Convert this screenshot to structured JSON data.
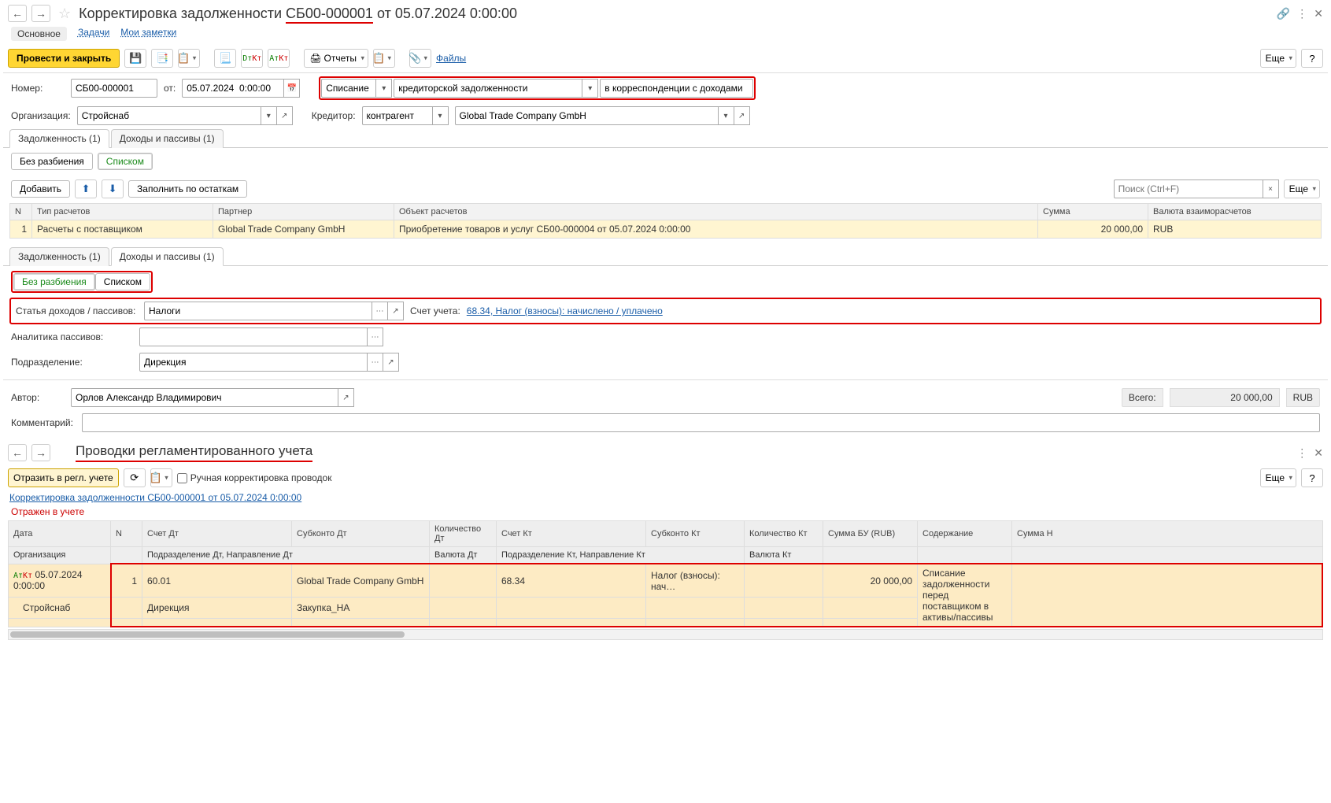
{
  "header": {
    "title_prefix": "Корректировка задолженности ",
    "title_highlight": "СБ00-000001",
    "title_suffix": " от 05.07.2024 0:00:00"
  },
  "nav": {
    "main": "Основное",
    "tasks": "Задачи",
    "notes": "Мои заметки"
  },
  "toolbar": {
    "post_close": "Провести и закрыть",
    "reports": "Отчеты",
    "files": "Файлы",
    "more": "Еще"
  },
  "fields": {
    "number_label": "Номер:",
    "number": "СБ00-000001",
    "from_label": "от:",
    "date": "05.07.2024  0:00:00",
    "op1": "Списание",
    "op2": "кредиторской задолженности",
    "op3": "в корреспонденции с доходами",
    "org_label": "Организация:",
    "org": "Стройснаб",
    "creditor_label": "Кредитор:",
    "creditor_type": "контрагент",
    "creditor": "Global Trade Company GmbH"
  },
  "tabs1": {
    "t1": "Задолженность (1)",
    "t2": "Доходы и пассивы (1)"
  },
  "subtb1": {
    "no_split": "Без разбиения",
    "list": "Списком",
    "add": "Добавить",
    "fill": "Заполнить по остаткам",
    "search_ph": "Поиск (Ctrl+F)",
    "more": "Еще"
  },
  "table1": {
    "cols": {
      "n": "N",
      "type": "Тип расчетов",
      "partner": "Партнер",
      "obj": "Объект расчетов",
      "sum": "Сумма",
      "curr": "Валюта взаиморасчетов"
    },
    "row": {
      "n": "1",
      "type": "Расчеты с поставщиком",
      "partner": "Global Trade Company GmbH",
      "obj": "Приобретение товаров и услуг СБ00-000004 от 05.07.2024 0:00:00",
      "sum": "20 000,00",
      "curr": "RUB"
    }
  },
  "tabs2": {
    "t1": "Задолженность (1)",
    "t2": "Доходы и пассивы (1)"
  },
  "subtb2": {
    "no_split": "Без разбиения",
    "list": "Списком"
  },
  "block2": {
    "art_label": "Статья доходов / пассивов:",
    "art": "Налоги",
    "acct_label": "Счет учета:",
    "acct_link": "68.34, Налог (взносы): начислено / уплачено",
    "analytics_label": "Аналитика пассивов:",
    "dep_label": "Подразделение:",
    "dep": "Дирекция"
  },
  "footer1": {
    "author_label": "Автор:",
    "author": "Орлов Александр Владимирович",
    "total_label": "Всего:",
    "total": "20 000,00",
    "curr": "RUB",
    "comment_label": "Комментарий:"
  },
  "section2": {
    "title": "Проводки регламентированного учета",
    "reflect": "Отразить в регл. учете",
    "manual": "Ручная корректировка проводок",
    "more": "Еще",
    "doc_link": "Корректировка задолженности СБ00-000001 от 05.07.2024 0:00:00",
    "status": "Отражен в учете"
  },
  "ledger": {
    "h": {
      "date": "Дата",
      "n": "N",
      "dt": "Счет Дт",
      "sdt": "Субконто Дт",
      "qdt": "Количество Дт",
      "kt": "Счет Кт",
      "skt": "Субконто Кт",
      "qkt": "Количество Кт",
      "sum": "Сумма БУ (RUB)",
      "cont": "Содержание",
      "sumn": "Сумма Н"
    },
    "h2": {
      "org": "Организация",
      "dep_dt": "Подразделение Дт, Направление Дт",
      "cur_dt": "Валюта Дт",
      "dep_kt": "Подразделение Кт, Направление Кт",
      "cur_kt": "Валюта Кт"
    },
    "r": {
      "date": "05.07.2024 0:00:00",
      "n": "1",
      "dt": "60.01",
      "sdt": "Global Trade Company GmbH",
      "kt": "68.34",
      "skt": "Налог (взносы): нач…",
      "sum": "20 000,00",
      "cont": "Списание задолженности перед поставщиком в активы/пассивы",
      "org": "Стройснаб",
      "dep": "Дирекция",
      "dir": "Закупка_НА"
    }
  }
}
